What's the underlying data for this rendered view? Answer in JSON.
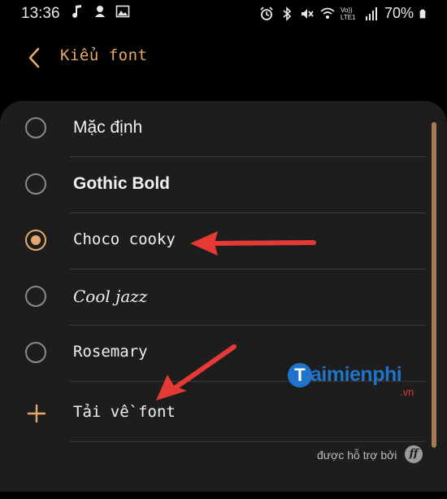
{
  "status_bar": {
    "time": "13:36",
    "battery_text": "70%",
    "network_label": "Vo)) LTE1"
  },
  "header": {
    "title": "Kiểu font",
    "back_icon": "chevron-left-icon"
  },
  "font_list": {
    "items": [
      {
        "label": "Mặc định",
        "selected": false
      },
      {
        "label": "Gothic Bold",
        "selected": false
      },
      {
        "label": "Choco cooky",
        "selected": true
      },
      {
        "label": "Cool jazz",
        "selected": false
      },
      {
        "label": "Rosemary",
        "selected": false
      }
    ],
    "download_label": "Tải về font"
  },
  "footer": {
    "powered_by": "được hỗ trợ bởi",
    "provider_icon_letter": "ff"
  },
  "watermark": {
    "brand_initial": "T",
    "brand": "aimienphi",
    "suffix": ".vn"
  },
  "colors": {
    "accent": "#e6a86a",
    "card_bg": "#1d1d1d",
    "annotation_arrow": "#e53935",
    "watermark_blue": "#1f74c9"
  }
}
